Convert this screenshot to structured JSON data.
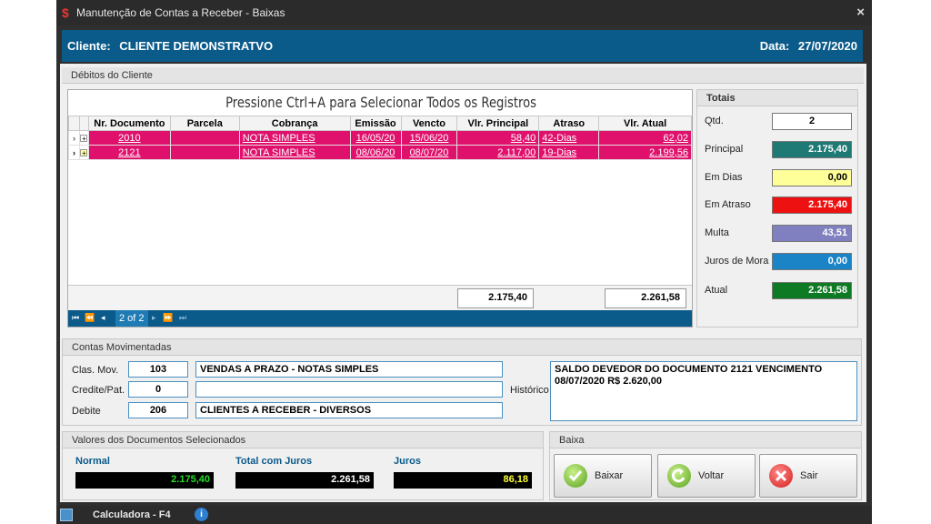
{
  "window": {
    "title": "Manutenção de Contas a Receber - Baixas",
    "close": "×"
  },
  "client": {
    "label": "Cliente:",
    "name": "CLIENTE DEMONSTRATVO",
    "date_label": "Data:",
    "date": "27/07/2020"
  },
  "debitos": {
    "title": "Débitos do Cliente",
    "hint": "Pressione Ctrl+A para Selecionar Todos os Registros",
    "columns": [
      "Nr. Documento",
      "Parcela",
      "Cobrança",
      "Emissão",
      "Vencto",
      "Vlr. Principal",
      "Atraso",
      "Vlr. Atual"
    ],
    "rows": [
      {
        "doc": "2010",
        "parcela": "",
        "cobranca": "NOTA SIMPLES",
        "emissao": "16/05/20",
        "vencto": "15/06/20",
        "principal": "58,40",
        "atraso": "42-Dias",
        "atual": "62,02"
      },
      {
        "doc": "2121",
        "parcela": "",
        "cobranca": "NOTA SIMPLES",
        "emissao": "08/06/20",
        "vencto": "08/07/20",
        "principal": "2.117,00",
        "atraso": "19-Dias",
        "atual": "2.199,56"
      }
    ],
    "footer_principal": "2.175,40",
    "footer_atual": "2.261,58",
    "page": "2 of 2"
  },
  "totais": {
    "title": "Totais",
    "items": [
      {
        "label": "Qtd.",
        "value": "2",
        "bg": "#ffffff",
        "fg": "#000000"
      },
      {
        "label": "Principal",
        "value": "2.175,40",
        "bg": "#1f7a75",
        "fg": "#ffffff"
      },
      {
        "label": "Em Dias",
        "value": "0,00",
        "bg": "#ffff99",
        "fg": "#000000"
      },
      {
        "label": "Em Atraso",
        "value": "2.175,40",
        "bg": "#ee1111",
        "fg": "#ffffff"
      },
      {
        "label": "Multa",
        "value": "43,51",
        "bg": "#8080c0",
        "fg": "#ffffff"
      },
      {
        "label": "Juros de Mora",
        "value": "0,00",
        "bg": "#1a84c7",
        "fg": "#ffffff"
      },
      {
        "label": "Atual",
        "value": "2.261,58",
        "bg": "#0f7a24",
        "fg": "#ffffff"
      }
    ]
  },
  "contas": {
    "title": "Contas Movimentadas",
    "clas_label": "Clas. Mov.",
    "clas_code": "103",
    "clas_desc": "VENDAS A PRAZO - NOTAS SIMPLES",
    "credite_label": "Credite/Pat.",
    "credite_code": "0",
    "credite_desc": "",
    "debite_label": "Debite",
    "debite_code": "206",
    "debite_desc": "CLIENTES A RECEBER - DIVERSOS",
    "historico_label": "Histórico",
    "historico": "SALDO DEVEDOR DO DOCUMENTO 2121 VENCIMENTO 08/07/2020 R$ 2.620,00"
  },
  "valores": {
    "title": "Valores dos Documentos Selecionados",
    "normal_label": "Normal",
    "normal": "2.175,40",
    "total_label": "Total com Juros",
    "total": "2.261,58",
    "juros_label": "Juros",
    "juros": "86,18"
  },
  "baixa": {
    "title": "Baixa",
    "baixar": "Baixar",
    "voltar": "Voltar",
    "sair": "Sair"
  },
  "status": {
    "calc": "Calculadora - F4"
  }
}
